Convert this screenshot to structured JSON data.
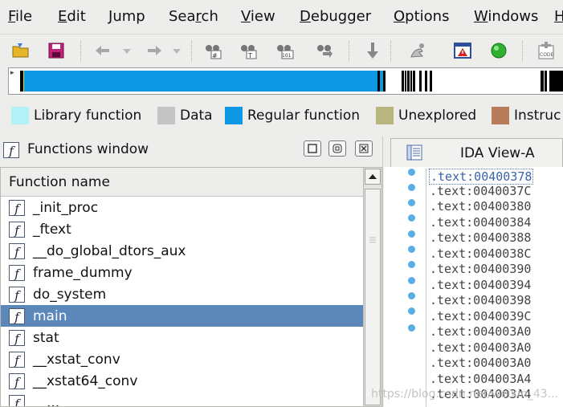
{
  "menu": [
    "File",
    "Edit",
    "Jump",
    "Search",
    "View",
    "Debugger",
    "Options",
    "Windows",
    "H"
  ],
  "menu_mnemonic_index": [
    0,
    0,
    0,
    3,
    0,
    0,
    0,
    0,
    0
  ],
  "toolbar_icons": [
    "open-folder-icon",
    "save-icon",
    "back-arrow-icon",
    "forward-arrow-icon",
    "binoculars-hex-icon",
    "binoculars-text-icon",
    "binoculars-binary-icon",
    "binoculars-next-icon",
    "jump-down-arrow-icon",
    "debugger-hand-icon",
    "warning-window-icon",
    "run-green-icon",
    "code-icon"
  ],
  "legend": [
    {
      "label": "Library function",
      "color": "#b3f0f8"
    },
    {
      "label": "Data",
      "color": "#c4c4c4"
    },
    {
      "label": "Regular function",
      "color": "#0e97e3"
    },
    {
      "label": "Unexplored",
      "color": "#b6b67e"
    },
    {
      "label": "Instruc",
      "color": "#b87c5b"
    }
  ],
  "functions_window": {
    "title": "Functions window",
    "column": "Function name",
    "items": [
      "_init_proc",
      "_ftext",
      "__do_global_dtors_aux",
      "frame_dummy",
      "do_system",
      "main",
      "stat",
      "__xstat_conv",
      "__xstat64_conv",
      "__..."
    ],
    "selected_index": 5
  },
  "ida_view": {
    "title": "IDA View-A",
    "lines": [
      ".text:00400378",
      ".text:0040037C",
      ".text:00400380",
      ".text:00400384",
      ".text:00400388",
      ".text:0040038C",
      ".text:00400390",
      ".text:00400394",
      ".text:00400398",
      ".text:0040039C",
      ".text:004003A0",
      ".text:004003A0",
      ".text:004003A0",
      ".text:004003A4",
      ".text:004003A4"
    ]
  },
  "watermark": "https://blog.csdn.net/weixin_43..."
}
